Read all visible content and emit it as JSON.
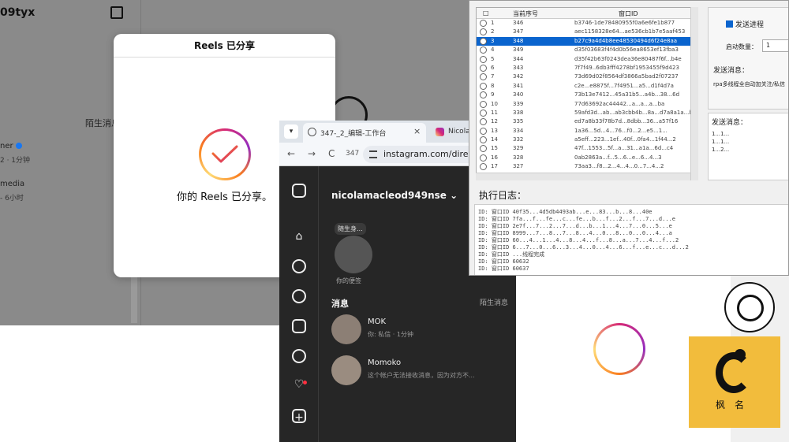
{
  "bg_instagram": {
    "username": "09tyx",
    "strangers_label": "陌生消息",
    "item1_name": "ner",
    "item1_time": "2 · 1分钟",
    "item2_name": "media",
    "item2_time": "- 6小时"
  },
  "reels_modal": {
    "title": "Reels 已分享",
    "message": "你的 Reels 已分享。"
  },
  "browser": {
    "tab1_title": "347-_2_编辑-工作台",
    "tab1_close": "×",
    "tab2_title": "Nicola",
    "back": "←",
    "forward": "→",
    "reload": "C",
    "tab_number": "347",
    "url": "instagram.com/direct/"
  },
  "ig": {
    "username": "nicolamacleod949nse",
    "note_bubble": "随生身...",
    "your_note": "你的便签",
    "messages_label": "消息",
    "strangers_label": "陌生消息",
    "conversations": [
      {
        "name": "MOK",
        "sub": "你: 私信 · 1分钟"
      },
      {
        "name": "Momoko",
        "sub": "这个帐户无法接收消息，因为对方不..."
      }
    ]
  },
  "tool": {
    "headers": {
      "col_check": "□",
      "col_id": "当前序号",
      "col_window": "窗口ID"
    },
    "rows": [
      {
        "idx": "1",
        "seq": "346",
        "win": "b3746-1de78480955f0a6e6fe1b877"
      },
      {
        "idx": "2",
        "seq": "347",
        "win": "aec1158328e64...ae536cb1b7e5aaf453"
      },
      {
        "idx": "3",
        "seq": "348",
        "win": "b27c9a4d4b8ee48530494d6f24e8aa"
      },
      {
        "idx": "4",
        "seq": "349",
        "win": "d35f03683f4f4d0b56ea8653ef13fba3"
      },
      {
        "idx": "5",
        "seq": "344",
        "win": "d35f42b63f0243dea36e80487f6f...b4e"
      },
      {
        "idx": "6",
        "seq": "343",
        "win": "7f7f49..6db3fff4278bf1953455f9d423"
      },
      {
        "idx": "7",
        "seq": "342",
        "win": "73d69d02f8564df3866a5bad2f07237"
      },
      {
        "idx": "8",
        "seq": "341",
        "win": "c2e...e8875f...7f4951...a5...d1f4d7a"
      },
      {
        "idx": "9",
        "seq": "340",
        "win": "73b13e7412...45a31b5...a4b...38...6d"
      },
      {
        "idx": "10",
        "seq": "339",
        "win": "77d63692ac44442...a...a...a...ba"
      },
      {
        "idx": "11",
        "seq": "338",
        "win": "59afd3d...ab...ab3cbb4b...8a...d7a8a1a...b"
      },
      {
        "idx": "12",
        "seq": "335",
        "win": "ed7a8b33f78b7d...8dbb...36...a57f16"
      },
      {
        "idx": "13",
        "seq": "334",
        "win": "1a36...5d...4...76...f0...2...e5...1..."
      },
      {
        "idx": "14",
        "seq": "332",
        "win": "a5eff...223...1ef...40f...0fa4...1f44...2"
      },
      {
        "idx": "15",
        "seq": "329",
        "win": "47f...1553...5f...a...31...a1a...6d...c4"
      },
      {
        "idx": "16",
        "seq": "328",
        "win": "0ab2863a...f...5...6...e...6...4...3"
      },
      {
        "idx": "17",
        "seq": "327",
        "win": "73aa3...f8...2...4...4...0...7...4...2"
      }
    ],
    "auto_label": "发送进程",
    "threads_label": "启动数量：",
    "threads_value": "1",
    "send_label": "发送消息：",
    "send_text": "rpa多线程全自动加关注/私信",
    "msg_label": "发送消息：",
    "msg_lines": [
      "1...1...",
      "1...1...",
      "1...2..."
    ],
    "log_label": "执行日志：",
    "log_lines": [
      "ID: 窗口ID 40f35...4d5db4493ab...e...83...b...8...40e",
      "ID: 窗口ID 7fa...f...fe...c...fe...b...f...2...f...7...d...e",
      "ID: 窗口ID 2e7f...7...2...7...d...b...1...4...7...0...5...e",
      "ID: 窗口ID 8999...7...8...7...8...4...0...8...0...0...4...a",
      "ID: 窗口ID 60...4...1...4...8...4...f...8...a...7...4...f...2",
      "ID: 窗口ID 6...7...0...6...3...4...0...4...6...f...e...c...d...2",
      "ID: 窗口ID ...线程完成",
      "ID: 窗口ID 60632",
      "ID: 窗口ID 60637"
    ]
  },
  "watermark": {
    "text": "枫名"
  },
  "colors": {
    "ig_gradient_pink": "#d62976",
    "ig_gradient_purple": "#962fbf",
    "ig_gradient_orange": "#fa7e1e",
    "selection_blue": "#0a64ce",
    "watermark_yellow": "#f2bc3c"
  }
}
